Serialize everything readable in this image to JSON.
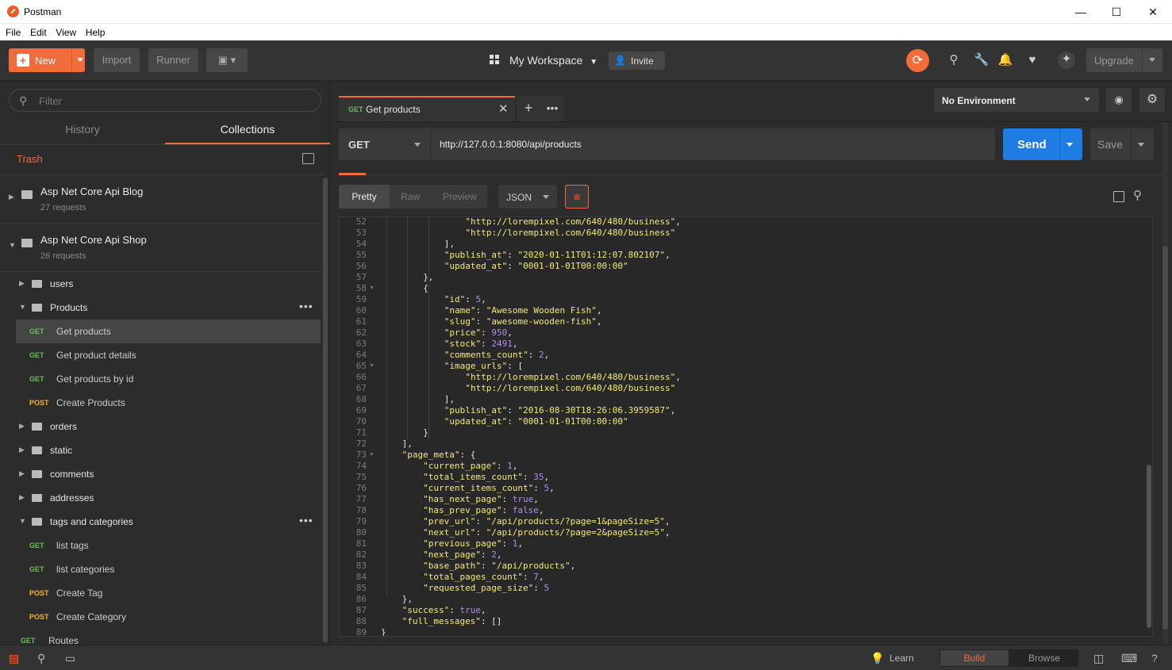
{
  "window": {
    "title": "Postman",
    "minimize": "—",
    "maximize": "☐",
    "close": "✕"
  },
  "menu": [
    "File",
    "Edit",
    "View",
    "Help"
  ],
  "toolbar": {
    "new_label": "New",
    "import_label": "Import",
    "runner_label": "Runner",
    "workspace_label": "My Workspace",
    "invite_label": "Invite",
    "upgrade_label": "Upgrade",
    "accent": "#f26b3a"
  },
  "sidebar": {
    "filter_placeholder": "Filter",
    "tabs": [
      "History",
      "Collections"
    ],
    "trash_label": "Trash",
    "collections": [
      {
        "name": "Asp Net Core Api Blog",
        "sub": "27 requests"
      },
      {
        "name": "Asp Net Core Api Shop",
        "sub": "26 requests"
      }
    ],
    "rows": [
      {
        "type": "folder",
        "name": "users"
      },
      {
        "type": "folder",
        "name": "Products",
        "open": true
      },
      {
        "type": "req",
        "method": "GET",
        "name": "Get products",
        "selected": true
      },
      {
        "type": "req",
        "method": "GET",
        "name": "Get product details"
      },
      {
        "type": "req",
        "method": "GET",
        "name": "Get products by id"
      },
      {
        "type": "req",
        "method": "POST",
        "name": "Create Products"
      },
      {
        "type": "folder",
        "name": "orders"
      },
      {
        "type": "folder",
        "name": "static"
      },
      {
        "type": "folder",
        "name": "comments"
      },
      {
        "type": "folder",
        "name": "addresses"
      },
      {
        "type": "folder",
        "name": "tags and categories",
        "open": true
      },
      {
        "type": "req",
        "method": "GET",
        "name": "list tags"
      },
      {
        "type": "req",
        "method": "GET",
        "name": "list categories"
      },
      {
        "type": "req",
        "method": "POST",
        "name": "Create Tag"
      },
      {
        "type": "req",
        "method": "POST",
        "name": "Create Category"
      },
      {
        "type": "req",
        "method": "GET",
        "name": "Routes"
      }
    ]
  },
  "request": {
    "tab_method": "GET",
    "tab_title": "Get products",
    "environment": "No Environment",
    "method": "GET",
    "url": "http://127.0.0.1:8080/api/products",
    "send_label": "Send",
    "save_label": "Save"
  },
  "response": {
    "formats": [
      "Pretty",
      "Raw",
      "Preview"
    ],
    "language": "JSON",
    "lines": [
      {
        "n": 52,
        "i": 4,
        "t": [
          [
            "s",
            "\"http://lorempixel.com/640/480/business\""
          ],
          [
            "p",
            ","
          ]
        ]
      },
      {
        "n": 53,
        "i": 4,
        "t": [
          [
            "s",
            "\"http://lorempixel.com/640/480/business\""
          ]
        ]
      },
      {
        "n": 54,
        "i": 3,
        "t": [
          [
            "p",
            "],"
          ]
        ]
      },
      {
        "n": 55,
        "i": 3,
        "t": [
          [
            "k",
            "\"publish_at\""
          ],
          [
            "p",
            ": "
          ],
          [
            "s",
            "\"2020-01-11T01:12:07.802107\""
          ],
          [
            "p",
            ","
          ]
        ]
      },
      {
        "n": 56,
        "i": 3,
        "t": [
          [
            "k",
            "\"updated_at\""
          ],
          [
            "p",
            ": "
          ],
          [
            "s",
            "\"0001-01-01T00:00:00\""
          ]
        ]
      },
      {
        "n": 57,
        "i": 2,
        "t": [
          [
            "p",
            "},"
          ]
        ]
      },
      {
        "n": 58,
        "i": 2,
        "t": [
          [
            "p",
            "{"
          ]
        ],
        "fold": true
      },
      {
        "n": 59,
        "i": 3,
        "t": [
          [
            "k",
            "\"id\""
          ],
          [
            "p",
            ": "
          ],
          [
            "n",
            "5"
          ],
          [
            "p",
            ","
          ]
        ]
      },
      {
        "n": 60,
        "i": 3,
        "t": [
          [
            "k",
            "\"name\""
          ],
          [
            "p",
            ": "
          ],
          [
            "s",
            "\"Awesome Wooden Fish\""
          ],
          [
            "p",
            ","
          ]
        ]
      },
      {
        "n": 61,
        "i": 3,
        "t": [
          [
            "k",
            "\"slug\""
          ],
          [
            "p",
            ": "
          ],
          [
            "s",
            "\"awesome-wooden-fish\""
          ],
          [
            "p",
            ","
          ]
        ]
      },
      {
        "n": 62,
        "i": 3,
        "t": [
          [
            "k",
            "\"price\""
          ],
          [
            "p",
            ": "
          ],
          [
            "n",
            "950"
          ],
          [
            "p",
            ","
          ]
        ]
      },
      {
        "n": 63,
        "i": 3,
        "t": [
          [
            "k",
            "\"stock\""
          ],
          [
            "p",
            ": "
          ],
          [
            "n",
            "2491"
          ],
          [
            "p",
            ","
          ]
        ]
      },
      {
        "n": 64,
        "i": 3,
        "t": [
          [
            "k",
            "\"comments_count\""
          ],
          [
            "p",
            ": "
          ],
          [
            "n",
            "2"
          ],
          [
            "p",
            ","
          ]
        ]
      },
      {
        "n": 65,
        "i": 3,
        "t": [
          [
            "k",
            "\"image_urls\""
          ],
          [
            "p",
            ": ["
          ]
        ],
        "fold": true
      },
      {
        "n": 66,
        "i": 4,
        "t": [
          [
            "s",
            "\"http://lorempixel.com/640/480/business\""
          ],
          [
            "p",
            ","
          ]
        ]
      },
      {
        "n": 67,
        "i": 4,
        "t": [
          [
            "s",
            "\"http://lorempixel.com/640/480/business\""
          ]
        ]
      },
      {
        "n": 68,
        "i": 3,
        "t": [
          [
            "p",
            "],"
          ]
        ]
      },
      {
        "n": 69,
        "i": 3,
        "t": [
          [
            "k",
            "\"publish_at\""
          ],
          [
            "p",
            ": "
          ],
          [
            "s",
            "\"2016-08-30T18:26:06.3959587\""
          ],
          [
            "p",
            ","
          ]
        ]
      },
      {
        "n": 70,
        "i": 3,
        "t": [
          [
            "k",
            "\"updated_at\""
          ],
          [
            "p",
            ": "
          ],
          [
            "s",
            "\"0001-01-01T00:00:00\""
          ]
        ]
      },
      {
        "n": 71,
        "i": 2,
        "t": [
          [
            "p",
            "}"
          ]
        ]
      },
      {
        "n": 72,
        "i": 1,
        "t": [
          [
            "p",
            "],"
          ]
        ]
      },
      {
        "n": 73,
        "i": 1,
        "t": [
          [
            "k",
            "\"page_meta\""
          ],
          [
            "p",
            ": {"
          ]
        ],
        "fold": true
      },
      {
        "n": 74,
        "i": 2,
        "t": [
          [
            "k",
            "\"current_page\""
          ],
          [
            "p",
            ": "
          ],
          [
            "n",
            "1"
          ],
          [
            "p",
            ","
          ]
        ]
      },
      {
        "n": 75,
        "i": 2,
        "t": [
          [
            "k",
            "\"total_items_count\""
          ],
          [
            "p",
            ": "
          ],
          [
            "n",
            "35"
          ],
          [
            "p",
            ","
          ]
        ]
      },
      {
        "n": 76,
        "i": 2,
        "t": [
          [
            "k",
            "\"current_items_count\""
          ],
          [
            "p",
            ": "
          ],
          [
            "n",
            "5"
          ],
          [
            "p",
            ","
          ]
        ]
      },
      {
        "n": 77,
        "i": 2,
        "t": [
          [
            "k",
            "\"has_next_page\""
          ],
          [
            "p",
            ": "
          ],
          [
            "n",
            "true"
          ],
          [
            "p",
            ","
          ]
        ]
      },
      {
        "n": 78,
        "i": 2,
        "t": [
          [
            "k",
            "\"has_prev_page\""
          ],
          [
            "p",
            ": "
          ],
          [
            "n",
            "false"
          ],
          [
            "p",
            ","
          ]
        ]
      },
      {
        "n": 79,
        "i": 2,
        "t": [
          [
            "k",
            "\"prev_url\""
          ],
          [
            "p",
            ": "
          ],
          [
            "s",
            "\"/api/products/?page=1&pageSize=5\""
          ],
          [
            "p",
            ","
          ]
        ]
      },
      {
        "n": 80,
        "i": 2,
        "t": [
          [
            "k",
            "\"next_url\""
          ],
          [
            "p",
            ": "
          ],
          [
            "s",
            "\"/api/products/?page=2&pageSize=5\""
          ],
          [
            "p",
            ","
          ]
        ]
      },
      {
        "n": 81,
        "i": 2,
        "t": [
          [
            "k",
            "\"previous_page\""
          ],
          [
            "p",
            ": "
          ],
          [
            "n",
            "1"
          ],
          [
            "p",
            ","
          ]
        ]
      },
      {
        "n": 82,
        "i": 2,
        "t": [
          [
            "k",
            "\"next_page\""
          ],
          [
            "p",
            ": "
          ],
          [
            "n",
            "2"
          ],
          [
            "p",
            ","
          ]
        ]
      },
      {
        "n": 83,
        "i": 2,
        "t": [
          [
            "k",
            "\"base_path\""
          ],
          [
            "p",
            ": "
          ],
          [
            "s",
            "\"/api/products\""
          ],
          [
            "p",
            ","
          ]
        ]
      },
      {
        "n": 84,
        "i": 2,
        "t": [
          [
            "k",
            "\"total_pages_count\""
          ],
          [
            "p",
            ": "
          ],
          [
            "n",
            "7"
          ],
          [
            "p",
            ","
          ]
        ]
      },
      {
        "n": 85,
        "i": 2,
        "t": [
          [
            "k",
            "\"requested_page_size\""
          ],
          [
            "p",
            ": "
          ],
          [
            "n",
            "5"
          ]
        ]
      },
      {
        "n": 86,
        "i": 1,
        "t": [
          [
            "p",
            "},"
          ]
        ]
      },
      {
        "n": 87,
        "i": 1,
        "t": [
          [
            "k",
            "\"success\""
          ],
          [
            "p",
            ": "
          ],
          [
            "n",
            "true"
          ],
          [
            "p",
            ","
          ]
        ]
      },
      {
        "n": 88,
        "i": 1,
        "t": [
          [
            "k",
            "\"full_messages\""
          ],
          [
            "p",
            ": []"
          ]
        ]
      },
      {
        "n": 89,
        "i": 0,
        "t": [
          [
            "p",
            "}"
          ]
        ]
      }
    ]
  },
  "statusbar": {
    "learn_label": "Learn",
    "build_label": "Build",
    "browse_label": "Browse"
  }
}
